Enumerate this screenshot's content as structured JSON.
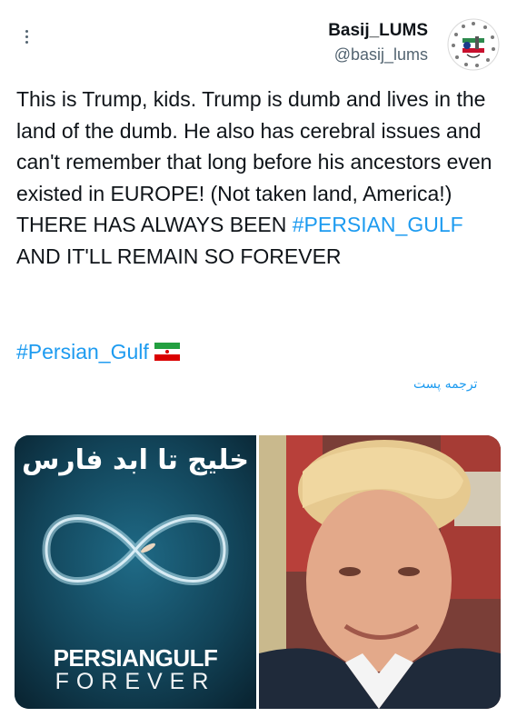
{
  "header": {
    "display_name": "Basij_LUMS",
    "handle": "@basij_lums"
  },
  "tweet": {
    "text_before": "This is Trump, kids. Trump is dumb and lives in the land of the dumb. He also has cerebral issues and can't remember that long before his ancestors even existed in EUROPE! (Not taken land, America!) THERE HAS ALWAYS BEEN ",
    "hashtag_inline": "#PERSIAN_GULF",
    "text_after": " AND IT'LL REMAIN SO FOREVER",
    "hashtag_line": "#Persian_Gulf",
    "translate_label": "ترجمه پست"
  },
  "media": {
    "left": {
      "arabic_title": "خلیج تا ابد فارس",
      "english_title": "PERSIANGULF",
      "english_sub": "FOREVER"
    }
  },
  "colors": {
    "link": "#1d9bf0",
    "text": "#0f1419",
    "secondary": "#536471"
  },
  "icons": {
    "more": "vertical-ellipsis-icon",
    "flag": "iran-flag-icon"
  }
}
